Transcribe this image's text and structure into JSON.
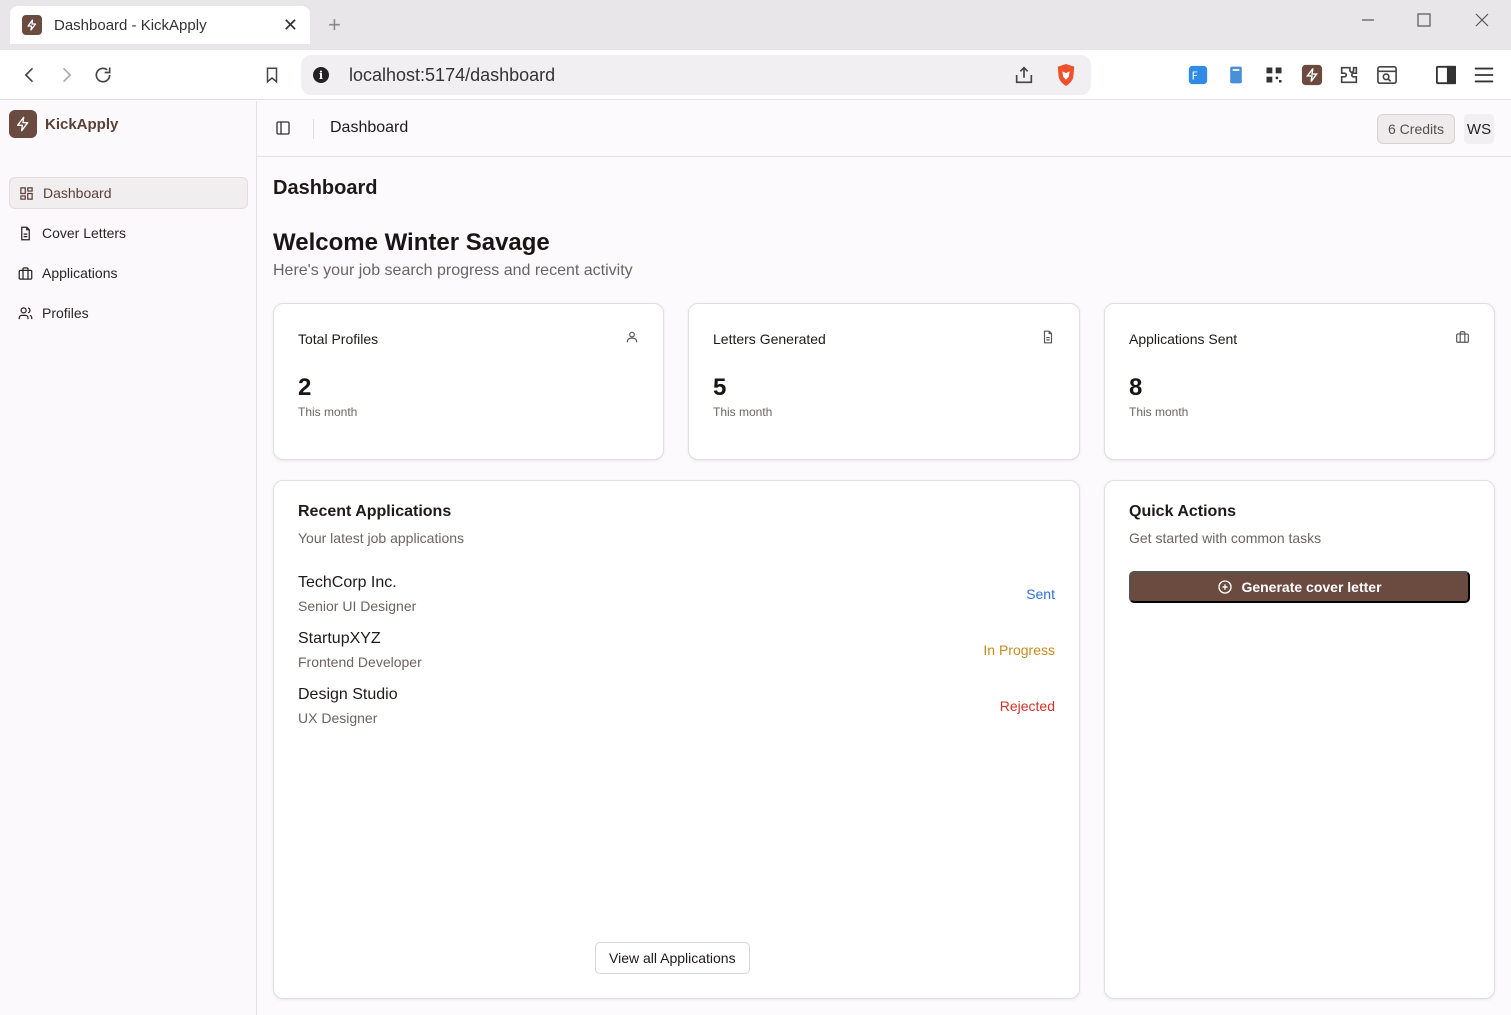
{
  "browser": {
    "tab_title": "Dashboard - KickApply",
    "tab_close": "✕",
    "new_tab": "+",
    "url": "localhost:5174/dashboard",
    "url_info": "i"
  },
  "sidebar": {
    "brand": "KickApply",
    "items": [
      {
        "label": "Dashboard",
        "icon": "grid-icon",
        "active": true
      },
      {
        "label": "Cover Letters",
        "icon": "file-text-icon",
        "active": false
      },
      {
        "label": "Applications",
        "icon": "briefcase-icon",
        "active": false
      },
      {
        "label": "Profiles",
        "icon": "users-icon",
        "active": false
      }
    ]
  },
  "header": {
    "title": "Dashboard",
    "credits": "6 Credits",
    "avatar_initials": "WS"
  },
  "main": {
    "page_title": "Dashboard",
    "welcome": "Welcome Winter Savage",
    "welcome_sub": "Here's your job search progress and recent activity"
  },
  "stats": [
    {
      "title": "Total Profiles",
      "value": "2",
      "sub": "This month",
      "icon": "user-icon"
    },
    {
      "title": "Letters Generated",
      "value": "5",
      "sub": "This month",
      "icon": "file-text-icon"
    },
    {
      "title": "Applications Sent",
      "value": "8",
      "sub": "This month",
      "icon": "briefcase-icon"
    }
  ],
  "recent": {
    "title": "Recent Applications",
    "subtitle": "Your latest job applications",
    "items": [
      {
        "company": "TechCorp Inc.",
        "role": "Senior UI Designer",
        "status": "Sent"
      },
      {
        "company": "StartupXYZ",
        "role": "Frontend Developer",
        "status": "In Progress"
      },
      {
        "company": "Design Studio",
        "role": "UX Designer",
        "status": "Rejected"
      }
    ],
    "view_all": "View all Applications"
  },
  "quick": {
    "title": "Quick Actions",
    "subtitle": "Get started with common tasks",
    "generate": "Generate cover letter"
  },
  "colors": {
    "brand": "#6b4a40",
    "status_sent": "#2f6fd1",
    "status_progress": "#c98a1b",
    "status_rejected": "#d4322c"
  }
}
